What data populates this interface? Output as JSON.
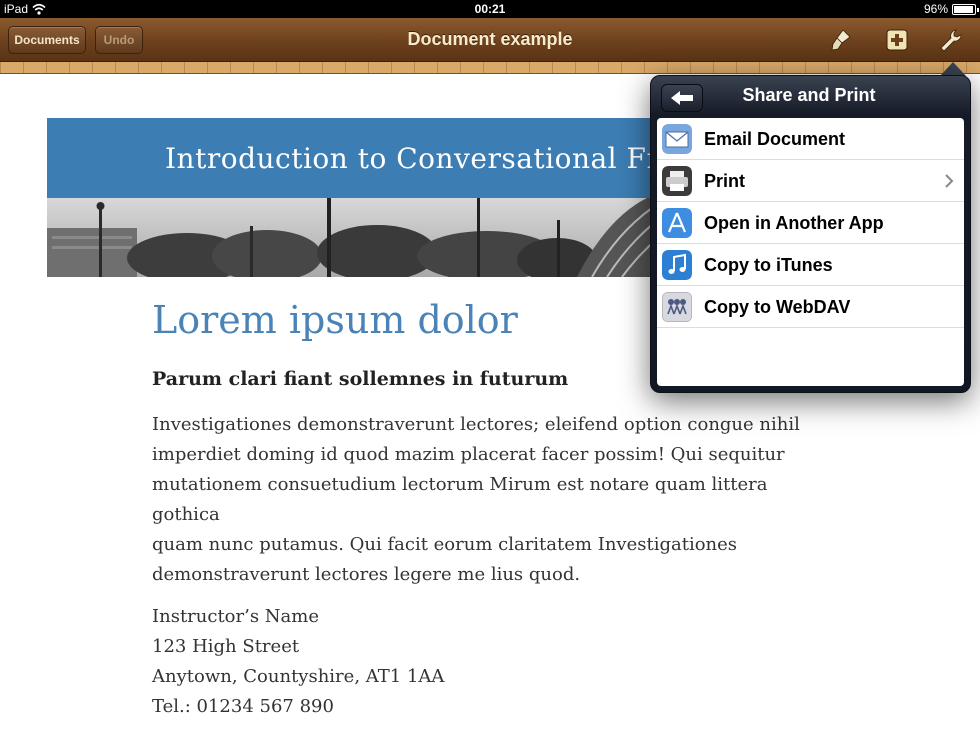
{
  "status_bar": {
    "device": "iPad",
    "time": "00:21",
    "battery": "96%",
    "battery_level": 0.96
  },
  "toolbar": {
    "documents_label": "Documents",
    "undo_label": "Undo",
    "title": "Document example",
    "icons": [
      "paintbrush-icon",
      "add-icon",
      "wrench-icon"
    ]
  },
  "document": {
    "banner_title": "Introduction to Conversational French",
    "heading": "Lorem ipsum dolor",
    "subheading": "Parum clari fiant sollemnes in futurum",
    "body_lines": [
      "Investigationes demonstraverunt lectores; eleifend option congue nihil",
      "imperdiet doming id quod mazim placerat facer possim! Qui sequitur",
      "mutationem consuetudium lectorum Mirum est notare quam littera gothica",
      "quam nunc putamus. Qui facit eorum claritatem Investigationes",
      "demonstraverunt lectores legere me lius quod."
    ],
    "contact": [
      "Instructor’s Name",
      "123 High Street",
      "Anytown, Countyshire, AT1 1AA",
      "Tel.: 01234 567 890"
    ]
  },
  "popover": {
    "title": "Share and Print",
    "items": [
      {
        "label": "Email Document",
        "icon": "mail-icon"
      },
      {
        "label": "Print",
        "icon": "printer-icon"
      },
      {
        "label": "Open in Another App",
        "icon": "app-store-icon"
      },
      {
        "label": "Copy to iTunes",
        "icon": "music-note-icon"
      },
      {
        "label": "Copy to WebDAV",
        "icon": "network-icon"
      }
    ]
  },
  "colors": {
    "banner": "#3c7db3",
    "heading": "#4a83b7",
    "toolbar_wood": "#6b3f1c"
  }
}
